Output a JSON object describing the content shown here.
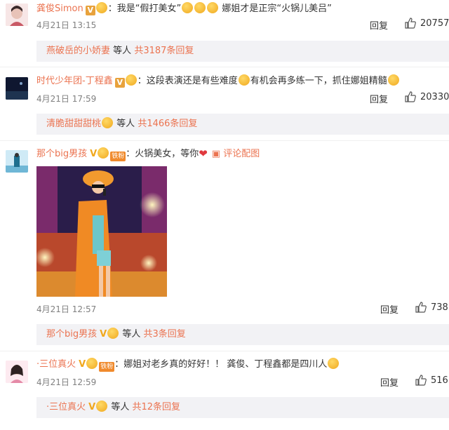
{
  "comments": [
    {
      "username": "龚俊Simon",
      "text_a": "：我是“假打美女”",
      "text_b": " 娜姐才是正宗“火锅儿美吕”",
      "time": "4月21日 13:15",
      "reply_label": "回复",
      "likes": "20757",
      "replies": {
        "user": "燕破岳的小娇妻",
        "mid": "等人",
        "count": "共3187条回复"
      }
    },
    {
      "username": "时代少年团-丁程鑫",
      "text_a": "：这段表演还是有些难度",
      "text_b": "有机会再多练一下，抓住娜姐精髓",
      "time": "4月21日 17:59",
      "reply_label": "回复",
      "likes": "20330",
      "replies": {
        "user": "清脆甜甜甜桃",
        "mid": "等人",
        "count": "共1466条回复"
      }
    },
    {
      "username": "那个big男孩",
      "fan_badge": "铁粉",
      "text_a": "：火锅美女，等你",
      "pic_link": "评论配图",
      "time": "4月21日 12:57",
      "reply_label": "回复",
      "likes": "738",
      "replies": {
        "user": "那个big男孩",
        "mid": "等人",
        "count": "共3条回复"
      }
    },
    {
      "username": "·三位真火",
      "fan_badge": "铁粉",
      "text_a": "：娜姐对老乡真的好好！！ 龚俊、丁程鑫都是四川人",
      "time": "4月21日 12:59",
      "reply_label": "回复",
      "likes": "516",
      "replies": {
        "user": "·三位真火",
        "mid": "等人",
        "count": "共12条回复"
      }
    }
  ],
  "colors": {
    "username": "#eb7350",
    "badge_gold": "#f0a81e",
    "reply_bg": "#f2f2f5"
  }
}
